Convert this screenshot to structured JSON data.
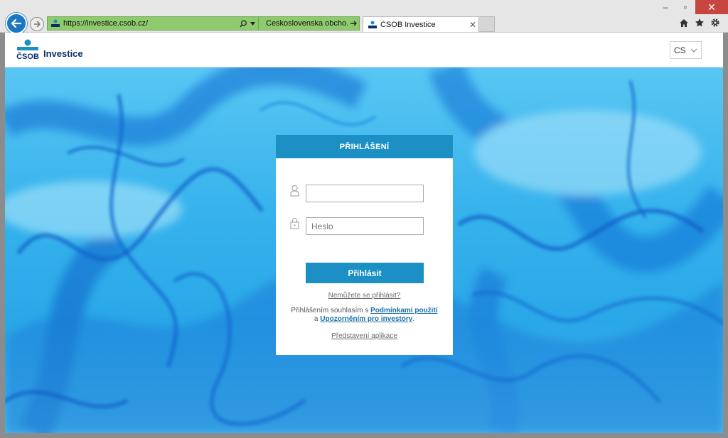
{
  "browser": {
    "url": "https://investice.csob.cz/",
    "cert_label": "Ceskoslovenska obcho...",
    "tab_title": "ČSOB Investice",
    "window_controls": {
      "minimize": "–",
      "maximize": "▫",
      "close": "✕"
    }
  },
  "header": {
    "logo_text": "Investice",
    "logo_mark": "ČSOB",
    "language": "CS"
  },
  "login": {
    "title": "PŘIHLÁŠENÍ",
    "username_value": "",
    "password_placeholder": "Heslo",
    "submit_label": "Přihlásit",
    "cant_login_link": "Nemůžete se přihlásit?",
    "consent_prefix": "Přihlášením souhlasím s ",
    "terms_link": "Podmínkami použití",
    "consent_and": "a ",
    "investor_notice_link": "Upozorněním pro investory",
    "consent_suffix": ".",
    "app_intro_link": "Představení aplikace"
  },
  "colors": {
    "brand_blue": "#1c90c4",
    "logo_navy": "#0b2e6b",
    "address_bar_green": "#8fca6e"
  }
}
